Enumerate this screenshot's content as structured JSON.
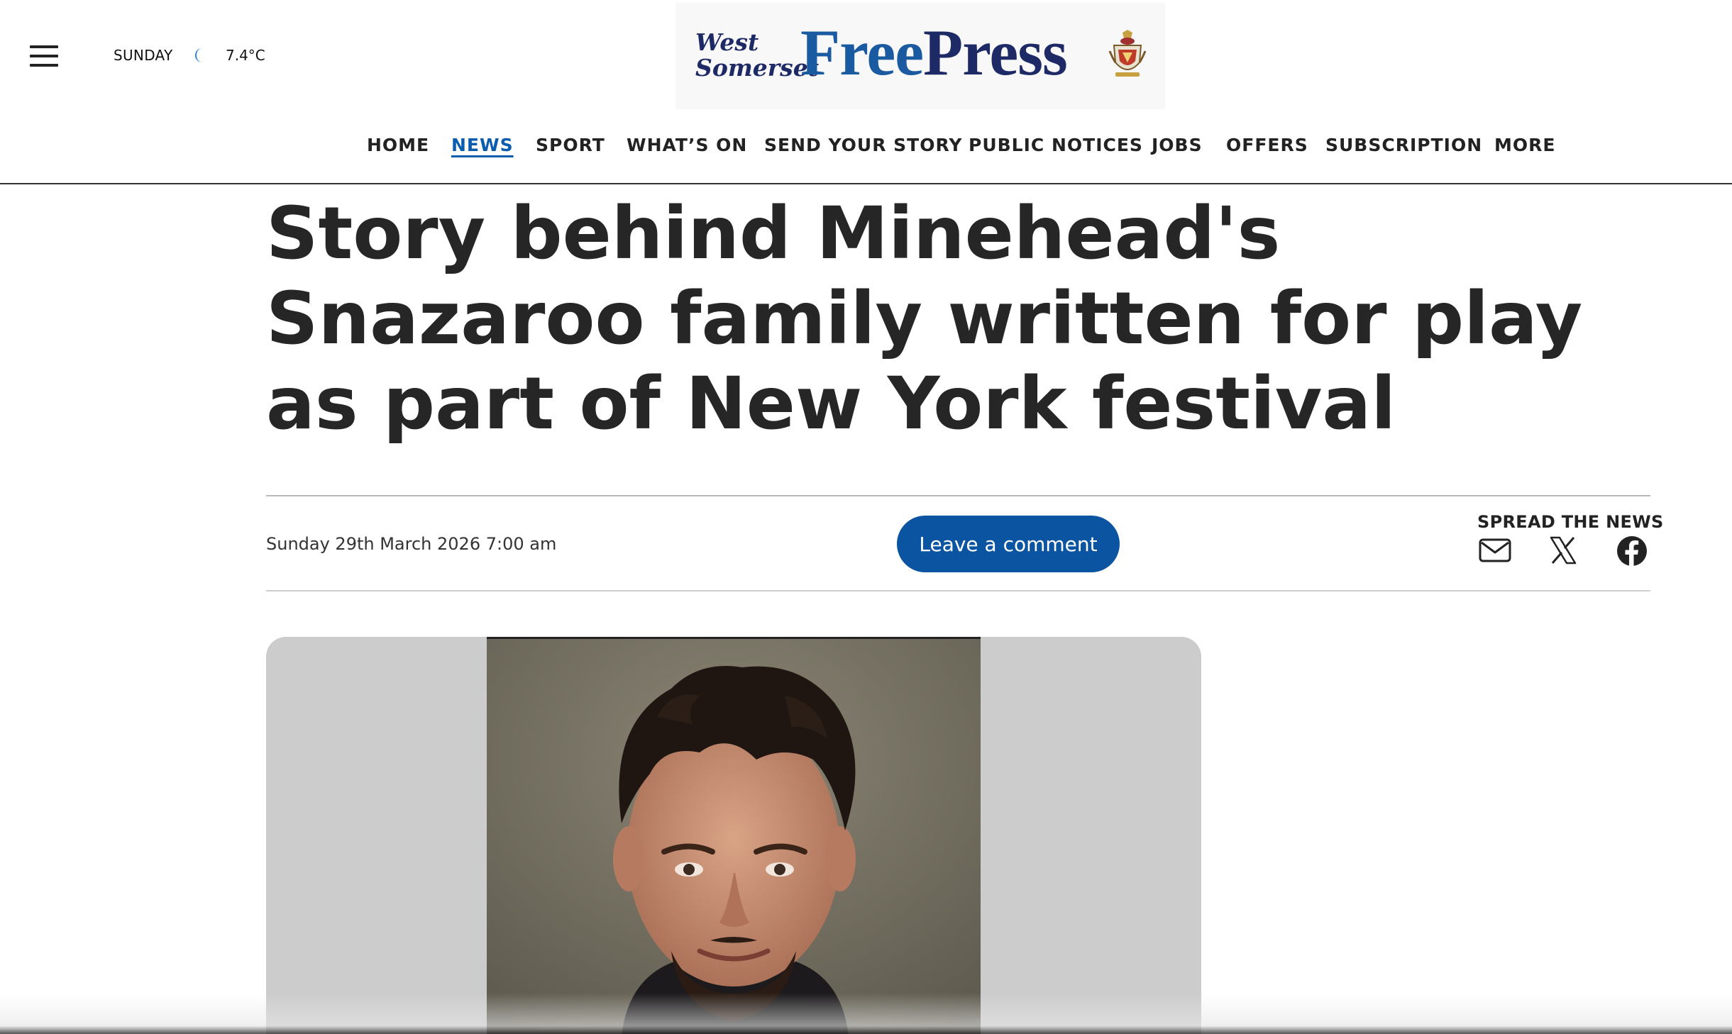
{
  "header": {
    "day": "SUNDAY",
    "weather_icon": "moon-icon",
    "temperature": "7.4°C",
    "logo": {
      "line1": "West",
      "line2": "Somerset",
      "free": "Free",
      "press": "Press"
    }
  },
  "nav": {
    "items": [
      {
        "label": "HOME"
      },
      {
        "label": "NEWS",
        "active": true
      },
      {
        "label": "SPORT"
      },
      {
        "label": "WHAT’S ON"
      },
      {
        "label": "SEND YOUR STORY"
      },
      {
        "label": "PUBLIC NOTICES"
      },
      {
        "label": "JOBS"
      },
      {
        "label": "OFFERS"
      },
      {
        "label": "SUBSCRIPTION"
      },
      {
        "label": "MORE"
      }
    ]
  },
  "article": {
    "headline": "Story behind Minehead's Snazaroo family written for play as part of New York festival",
    "dateline": "Sunday 29th March 2026 7:00 am",
    "comment_button": "Leave a comment",
    "share": {
      "label": "SPREAD THE NEWS",
      "icons": [
        "email-icon",
        "x-icon",
        "facebook-icon"
      ]
    }
  },
  "colors": {
    "accent": "#0a54a1",
    "text": "#262626",
    "image_background": "#cccccc"
  }
}
